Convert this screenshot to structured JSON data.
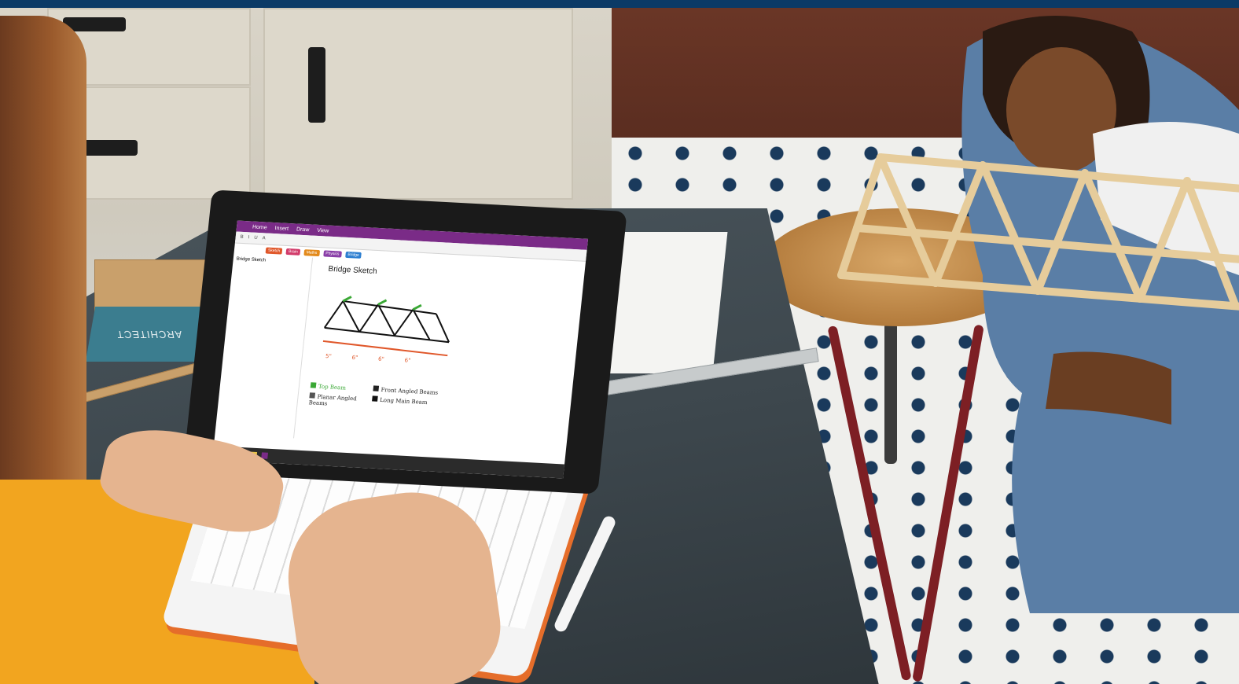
{
  "image": {
    "description_labels": {}
  },
  "laptop_screen": {
    "app_tabs": [
      "Home",
      "Insert",
      "Draw",
      "View"
    ],
    "section_tabs": [
      {
        "label": "Sketch",
        "color": "#e0572a"
      },
      {
        "label": "Brain",
        "color": "#d23b6a"
      },
      {
        "label": "Maths",
        "color": "#e38a1c"
      },
      {
        "label": "Physics",
        "color": "#8a3fa8"
      },
      {
        "label": "Bridge",
        "color": "#2d7fd1"
      }
    ],
    "page_list_item": "Bridge Sketch",
    "page_title": "Bridge Sketch",
    "sketch_legend": [
      {
        "label": "Top Beam",
        "color": "#3aa835"
      },
      {
        "label": "Planar Angled Beams",
        "color": "#555555"
      },
      {
        "label": "Front Angled Beams",
        "color": "#222222"
      },
      {
        "label": "Long Main Beam",
        "color": "#111111"
      }
    ],
    "dimension_labels": [
      "5\"",
      "6\"",
      "6\"",
      "6\""
    ]
  },
  "book_spine_text": "ARCHITECT",
  "colors": {
    "top_bar": "#0b3a66",
    "onenote_purple": "#7a2b87",
    "keyboard_accent": "#e56d2a",
    "shirt": "#f2a51f"
  }
}
